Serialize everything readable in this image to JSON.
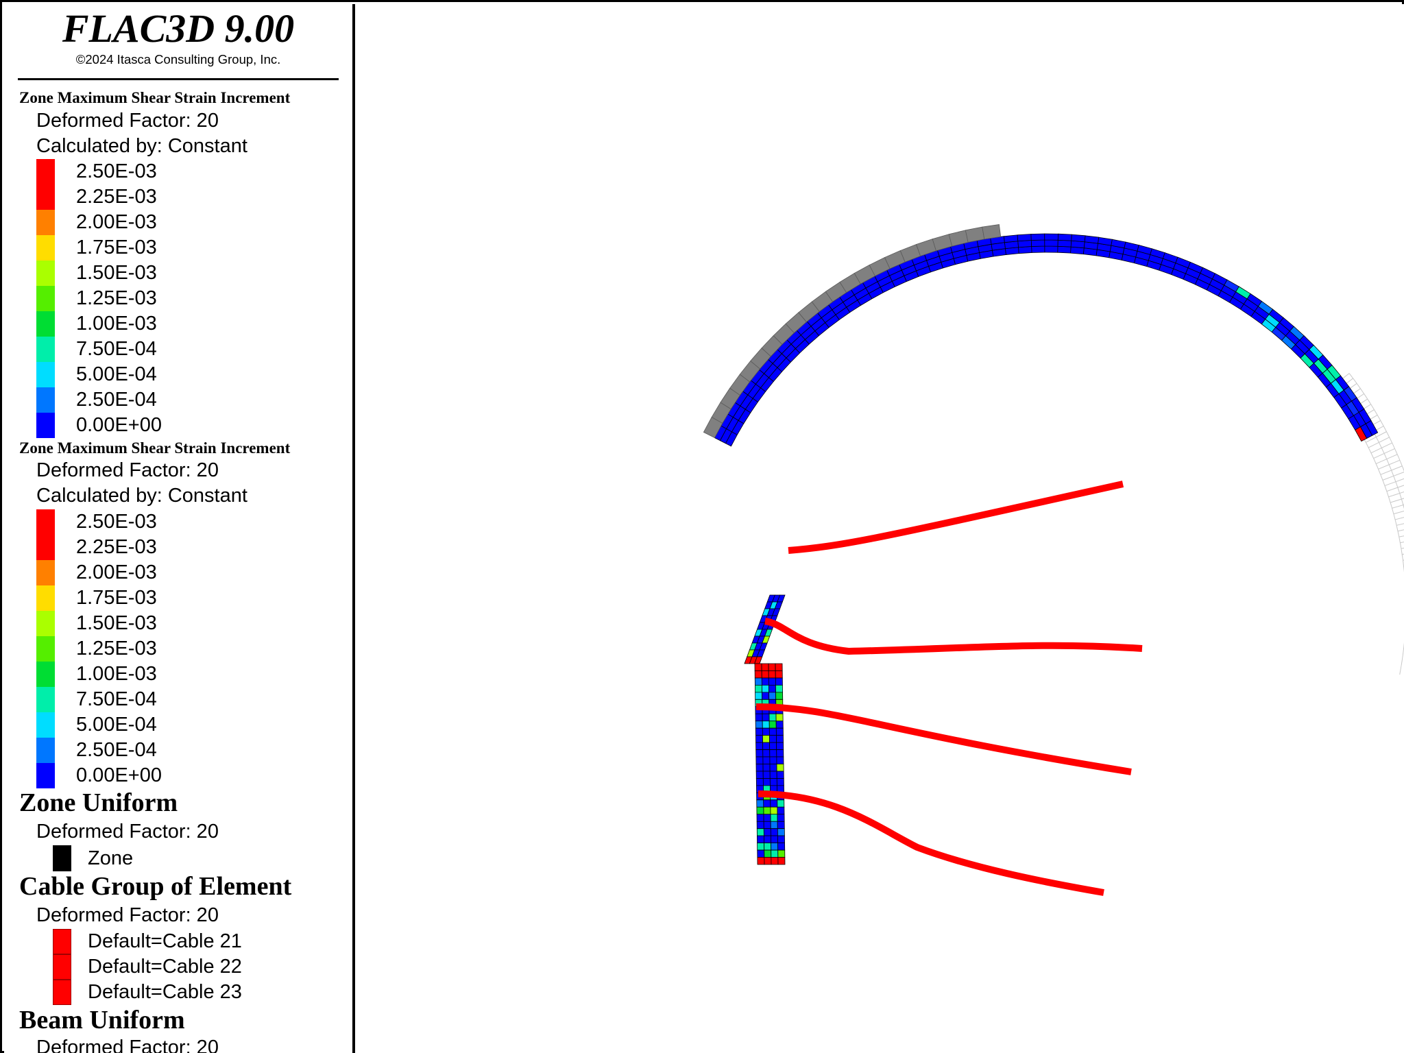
{
  "app": {
    "title": "FLAC3D 9.00",
    "copyright": "©2024 Itasca Consulting Group, Inc."
  },
  "legend": {
    "strain_sections": [
      {
        "title": "Zone Maximum Shear Strain Increment",
        "deformed_factor": "Deformed Factor: 20",
        "calculated_by": "Calculated by: Constant",
        "ticks": [
          "2.50E-03",
          "2.25E-03",
          "2.00E-03",
          "1.75E-03",
          "1.50E-03",
          "1.25E-03",
          "1.00E-03",
          "7.50E-04",
          "5.00E-04",
          "2.50E-04",
          "0.00E+00"
        ]
      },
      {
        "title": "Zone Maximum Shear Strain Increment",
        "deformed_factor": "Deformed Factor: 20",
        "calculated_by": "Calculated by: Constant",
        "ticks": [
          "2.50E-03",
          "2.25E-03",
          "2.00E-03",
          "1.75E-03",
          "1.50E-03",
          "1.25E-03",
          "1.00E-03",
          "7.50E-04",
          "5.00E-04",
          "2.50E-04",
          "0.00E+00"
        ]
      }
    ],
    "colorbar_colors": [
      "#ff0000",
      "#ff0000",
      "#ff8000",
      "#ffdd00",
      "#aaff00",
      "#55ee00",
      "#00dd33",
      "#00eeaa",
      "#00ddff",
      "#0077ff",
      "#0000ff"
    ],
    "zone_uniform": {
      "title": "Zone Uniform",
      "deformed_factor": "Deformed Factor: 20",
      "item_label": "Zone",
      "item_color": "#000000"
    },
    "cable_group": {
      "title": "Cable Group of Element",
      "deformed_factor": "Deformed Factor: 20",
      "items": [
        "Default=Cable 21",
        "Default=Cable 22",
        "Default=Cable 23"
      ],
      "item_color": "#ff0000"
    },
    "beam_uniform": {
      "title": "Beam Uniform",
      "deformed_factor": "Deformed Factor: 20"
    }
  },
  "model_view": {
    "colors": {
      "lining": "#0000ff",
      "beam": "#808080",
      "cable": "#ff0000",
      "undeformed_grid": "#c8c8c8",
      "mesh_line": "#000000"
    }
  }
}
